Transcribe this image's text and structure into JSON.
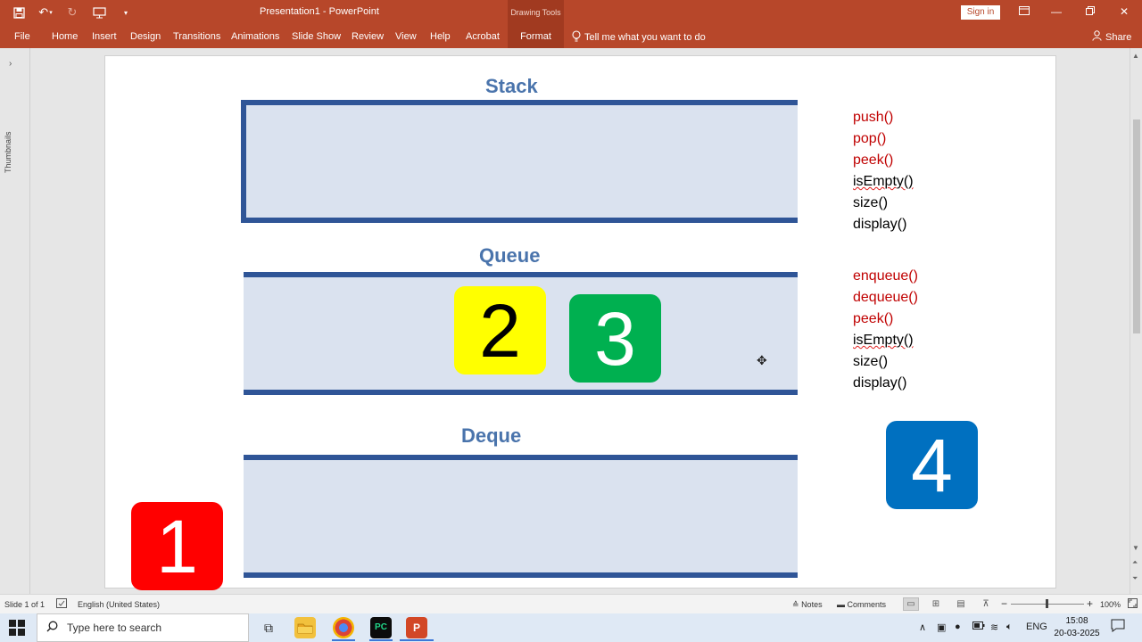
{
  "titlebar": {
    "title": "Presentation1  -  PowerPoint",
    "contextual_header": "Drawing Tools",
    "signin_label": "Sign in"
  },
  "ribbon": {
    "tabs": [
      "File",
      "Home",
      "Insert",
      "Design",
      "Transitions",
      "Animations",
      "Slide Show",
      "Review",
      "View",
      "Help",
      "Acrobat",
      "Format"
    ],
    "tell_me": "Tell me what you want to do",
    "share": "Share"
  },
  "thumbnails": {
    "label": "Thumbnails"
  },
  "slide": {
    "stack_title": "Stack",
    "queue_title": "Queue",
    "deque_title": "Deque",
    "stack_methods": [
      {
        "text": "push()",
        "color": "red"
      },
      {
        "text": "pop()",
        "color": "red"
      },
      {
        "text": "peek()",
        "color": "red"
      },
      {
        "text": "isEmpty()",
        "color": "black"
      },
      {
        "text": "size()",
        "color": "black"
      },
      {
        "text": "display()",
        "color": "black"
      }
    ],
    "queue_methods": [
      {
        "text": "enqueue()",
        "color": "red"
      },
      {
        "text": "dequeue()",
        "color": "red"
      },
      {
        "text": "peek()",
        "color": "red"
      },
      {
        "text": "isEmpty()",
        "color": "black"
      },
      {
        "text": "size()",
        "color": "black"
      },
      {
        "text": "display()",
        "color": "black"
      }
    ],
    "tiles": [
      {
        "label": "1",
        "bg": "#ff0000",
        "fg": "#ffffff"
      },
      {
        "label": "2",
        "bg": "#ffff00",
        "fg": "#000000"
      },
      {
        "label": "3",
        "bg": "#00b050",
        "fg": "#ffffff"
      },
      {
        "label": "4",
        "bg": "#0070c0",
        "fg": "#ffffff"
      }
    ],
    "colors": {
      "title_blue": "#4a74ac",
      "band_fill": "#dae2ef",
      "border_blue": "#2f5597",
      "method_red": "#c00000"
    }
  },
  "statusbar": {
    "slide_info": "Slide 1 of 1",
    "language": "English (United States)",
    "notes": "Notes",
    "comments": "Comments",
    "zoom": "100%"
  },
  "taskbar": {
    "search_placeholder": "Type here to search",
    "lang": "ENG",
    "time": "15:08",
    "date": "20-03-2025"
  }
}
